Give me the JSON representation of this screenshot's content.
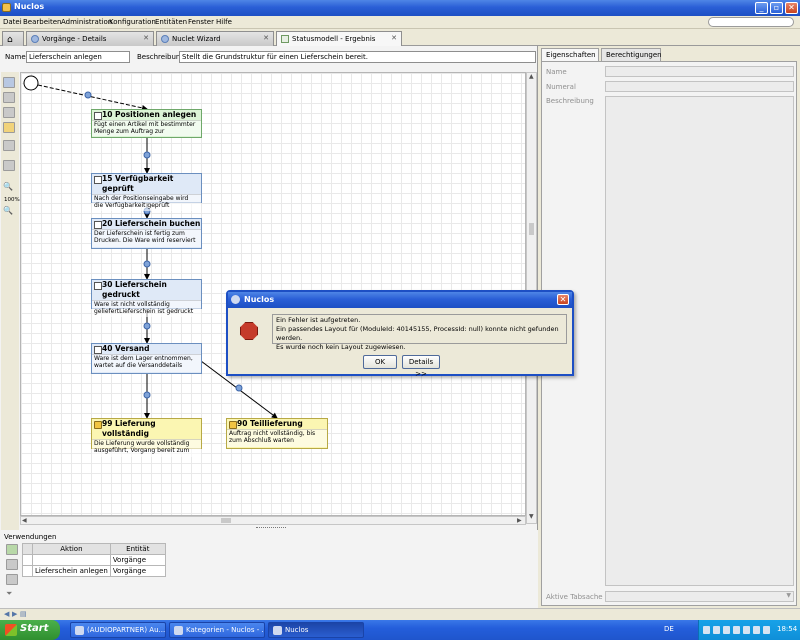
{
  "window": {
    "title": "Nuclos"
  },
  "menu": [
    "Datei",
    "Bearbeiten",
    "Administration",
    "Konfiguration",
    "Entitäten",
    "Fenster",
    "Hilfe"
  ],
  "tabs": [
    {
      "label": "Vorgänge - Details"
    },
    {
      "label": "Nuclet Wizard"
    },
    {
      "label": "Statusmodell - Ergebnis"
    }
  ],
  "editor": {
    "name_label": "Name",
    "name_value": "Lieferschein anlegen",
    "desc_label": "Beschreibung",
    "desc_value": "Stellt die Grundstruktur für einen Lieferschein bereit.",
    "zoom": "100%"
  },
  "nodes": [
    {
      "title": "10 Positionen anlegen",
      "desc": "Fügt einen Artikel mit bestimmter Menge zum Auftrag zur"
    },
    {
      "title": "15 Verfügbarkeit geprüft",
      "desc": "Nach der Positionseingabe wird die Verfügbarkeit geprüft"
    },
    {
      "title": "20 Lieferschein buchen",
      "desc": "Der Lieferschein ist fertig zum Drucken. Die Ware wird reserviert"
    },
    {
      "title": "30 Lieferschein gedruckt",
      "desc": "Ware ist nicht vollständig geliefertLieferschein ist gedruckt"
    },
    {
      "title": "40 Versand",
      "desc": "Ware ist dem Lager entnommen, wartet auf die Versanddetails"
    },
    {
      "title": "99 Lieferung vollständig",
      "desc": "Die Lieferung wurde vollständig ausgeführt, Vorgang bereit zum"
    },
    {
      "title": "90 Teillieferung",
      "desc": "Auftrag nicht vollständig, bis zum Abschluß warten"
    }
  ],
  "verwendungen": {
    "title": "Verwendungen",
    "columns": [
      "Aktion",
      "Entität"
    ],
    "rows": [
      {
        "aktion": "",
        "entitaet": "Vorgänge"
      },
      {
        "aktion": "Lieferschein anlegen",
        "entitaet": "Vorgänge"
      }
    ]
  },
  "right_panel": {
    "tabs": [
      "Eigenschaften",
      "Berechtigungen"
    ],
    "fields": [
      "Name",
      "Numeral",
      "Beschreibung"
    ],
    "bottom_label": "Aktive Tabsache"
  },
  "dialog": {
    "title": "Nuclos",
    "line1": "Ein Fehler ist aufgetreten.",
    "line2": "Ein passendes Layout für (ModuleId: 40145155, ProcessId: null) konnte nicht gefunden werden.",
    "line3": "Es wurde noch kein Layout zugewiesen.",
    "ok": "OK",
    "details": "Details >>"
  },
  "taskbar": {
    "start": "Start",
    "tasks": [
      "(AUDIOPARTNER) Au...",
      "Kategorien - Nuclos - ...",
      "Nuclos"
    ],
    "lang": "DE",
    "clock": "18:54"
  }
}
